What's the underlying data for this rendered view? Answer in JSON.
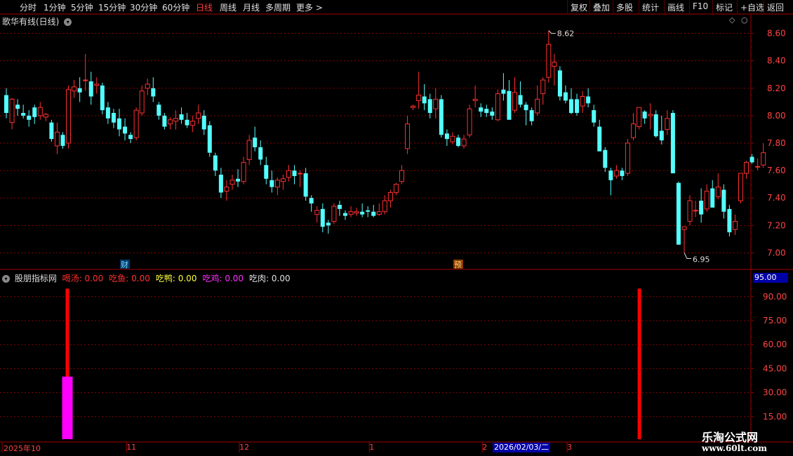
{
  "toolbar": {
    "periods": [
      "分时",
      "1分钟",
      "5分钟",
      "15分钟",
      "30分钟",
      "60分钟",
      "日线",
      "周线",
      "月线",
      "多周期",
      "更多 >"
    ],
    "active_period": "日线",
    "right_buttons": [
      "复权",
      "叠加",
      "多股",
      "统计",
      "画线",
      "F10",
      "标记",
      "+自选",
      "返回"
    ]
  },
  "main_panel": {
    "title": "歌华有线(日线)",
    "y_ticks": [
      "8.60",
      "8.40",
      "8.20",
      "8.00",
      "7.80",
      "7.60",
      "7.40",
      "7.20",
      "7.00"
    ],
    "high_marker": "8.62",
    "low_marker": "6.95",
    "event_markers": [
      {
        "label": "财",
        "index": 21
      },
      {
        "label": "预",
        "index": 80
      }
    ]
  },
  "indicator_panel": {
    "title": "股朋指标网",
    "indicators": [
      {
        "name": "喝汤",
        "value": "0.00",
        "color": "#ff3030"
      },
      {
        "name": "吃鱼",
        "value": "0.00",
        "color": "#ff3030"
      },
      {
        "name": "吃鸭",
        "value": "0.00",
        "color": "#ffff40"
      },
      {
        "name": "吃鸡",
        "value": "0.00",
        "color": "#ff30ff"
      },
      {
        "name": "吃肉",
        "value": "0.00",
        "color": "#e0e0e0"
      }
    ],
    "y_ticks": [
      "90.00",
      "75.00",
      "60.00",
      "45.00",
      "30.00",
      "15.00"
    ],
    "current_value": "95.00",
    "bars": [
      {
        "index": 10,
        "type": "line",
        "value": 95,
        "color": "#ff0000"
      },
      {
        "index": 10,
        "type": "box",
        "value": 40,
        "color": "#ff00ff"
      },
      {
        "index": 112,
        "type": "line",
        "value": 95,
        "color": "#ff0000"
      }
    ]
  },
  "x_axis": {
    "labels": [
      {
        "text": "2025年10",
        "index": 0
      },
      {
        "text": "11",
        "index": 22
      },
      {
        "text": "12",
        "index": 42
      },
      {
        "text": "1",
        "index": 65
      },
      {
        "text": "2",
        "index": 85
      },
      {
        "text": "3",
        "index": 100
      }
    ],
    "cursor_date": "2026/02/03/二"
  },
  "watermark": {
    "line1": "乐淘公式网",
    "line2": "www.60lt.com"
  },
  "colors": {
    "up": "#ff3030",
    "down": "#54ffff",
    "grid": "#8a0000",
    "axis_text": "#ff4444"
  },
  "chart_data": {
    "type": "candlestick",
    "ohlc": [
      [
        8.15,
        8.2,
        7.98,
        8.02
      ],
      [
        7.95,
        8.13,
        7.9,
        8.12
      ],
      [
        8.08,
        8.12,
        8.0,
        8.05
      ],
      [
        8.02,
        8.08,
        7.98,
        8.0
      ],
      [
        8.0,
        8.04,
        7.92,
        7.97
      ],
      [
        8.06,
        8.08,
        7.94,
        7.99
      ],
      [
        8.0,
        8.1,
        7.97,
        8.06
      ],
      [
        7.99,
        8.02,
        7.96,
        8.01
      ],
      [
        7.95,
        7.97,
        7.81,
        7.83
      ],
      [
        7.78,
        7.95,
        7.72,
        7.88
      ],
      [
        7.86,
        7.88,
        7.76,
        7.78
      ],
      [
        7.8,
        8.22,
        7.76,
        8.19
      ],
      [
        8.18,
        8.26,
        8.13,
        8.21
      ],
      [
        8.2,
        8.28,
        8.1,
        8.17
      ],
      [
        8.26,
        8.45,
        8.18,
        8.26
      ],
      [
        8.25,
        8.32,
        8.08,
        8.14
      ],
      [
        8.22,
        8.28,
        8.16,
        8.23
      ],
      [
        8.22,
        8.24,
        8.01,
        8.04
      ],
      [
        8.06,
        8.1,
        7.94,
        7.98
      ],
      [
        8.02,
        8.05,
        7.91,
        7.95
      ],
      [
        7.98,
        8.05,
        7.85,
        7.9
      ],
      [
        7.92,
        7.98,
        7.82,
        7.87
      ],
      [
        7.86,
        7.88,
        7.8,
        7.83
      ],
      [
        7.84,
        8.06,
        7.82,
        8.04
      ],
      [
        8.02,
        8.22,
        8.0,
        8.18
      ],
      [
        8.2,
        8.27,
        8.15,
        8.23
      ],
      [
        8.2,
        8.28,
        8.1,
        8.14
      ],
      [
        8.08,
        8.1,
        7.97,
        8.0
      ],
      [
        8.0,
        8.02,
        7.9,
        7.92
      ],
      [
        7.94,
        7.99,
        7.9,
        7.97
      ],
      [
        7.96,
        8.04,
        7.9,
        7.98
      ],
      [
        8.01,
        8.06,
        7.94,
        7.97
      ],
      [
        7.97,
        8.02,
        7.91,
        7.93
      ],
      [
        7.93,
        8.0,
        7.88,
        7.96
      ],
      [
        7.98,
        8.08,
        7.94,
        8.02
      ],
      [
        8.0,
        8.04,
        7.86,
        7.9
      ],
      [
        7.93,
        7.96,
        7.7,
        7.73
      ],
      [
        7.71,
        7.73,
        7.56,
        7.6
      ],
      [
        7.57,
        7.62,
        7.4,
        7.44
      ],
      [
        7.45,
        7.53,
        7.38,
        7.48
      ],
      [
        7.5,
        7.57,
        7.46,
        7.53
      ],
      [
        7.54,
        7.61,
        7.48,
        7.52
      ],
      [
        7.52,
        7.7,
        7.5,
        7.66
      ],
      [
        7.68,
        7.86,
        7.64,
        7.82
      ],
      [
        7.84,
        7.92,
        7.74,
        7.77
      ],
      [
        7.77,
        7.82,
        7.64,
        7.68
      ],
      [
        7.64,
        7.7,
        7.5,
        7.54
      ],
      [
        7.53,
        7.6,
        7.44,
        7.48
      ],
      [
        7.48,
        7.55,
        7.42,
        7.53
      ],
      [
        7.52,
        7.57,
        7.46,
        7.54
      ],
      [
        7.55,
        7.64,
        7.52,
        7.6
      ],
      [
        7.6,
        7.64,
        7.5,
        7.56
      ],
      [
        7.58,
        7.6,
        7.48,
        7.58
      ],
      [
        7.58,
        7.62,
        7.38,
        7.41
      ],
      [
        7.4,
        7.42,
        7.3,
        7.36
      ],
      [
        7.28,
        7.34,
        7.22,
        7.31
      ],
      [
        7.32,
        7.36,
        7.15,
        7.19
      ],
      [
        7.22,
        7.24,
        7.14,
        7.2
      ],
      [
        7.23,
        7.36,
        7.21,
        7.34
      ],
      [
        7.35,
        7.38,
        7.27,
        7.32
      ],
      [
        7.29,
        7.31,
        7.24,
        7.27
      ],
      [
        7.28,
        7.34,
        7.26,
        7.3
      ],
      [
        7.29,
        7.33,
        7.27,
        7.3
      ],
      [
        7.3,
        7.36,
        7.26,
        7.28
      ],
      [
        7.31,
        7.34,
        7.26,
        7.3
      ],
      [
        7.3,
        7.35,
        7.26,
        7.27
      ],
      [
        7.28,
        7.36,
        7.27,
        7.3
      ],
      [
        7.3,
        7.42,
        7.28,
        7.38
      ],
      [
        7.38,
        7.46,
        7.33,
        7.44
      ],
      [
        7.44,
        7.51,
        7.42,
        7.5
      ],
      [
        7.52,
        7.64,
        7.5,
        7.6
      ],
      [
        7.76,
        8.0,
        7.72,
        7.94
      ],
      [
        8.06,
        8.08,
        8.04,
        8.07
      ],
      [
        8.11,
        8.32,
        8.05,
        8.15
      ],
      [
        8.14,
        8.23,
        8.04,
        8.09
      ],
      [
        8.12,
        8.16,
        7.98,
        8.02
      ],
      [
        8.05,
        8.2,
        7.98,
        8.12
      ],
      [
        8.12,
        8.15,
        7.84,
        7.86
      ],
      [
        7.87,
        7.9,
        7.78,
        7.83
      ],
      [
        7.81,
        7.88,
        7.79,
        7.85
      ],
      [
        7.84,
        7.86,
        7.77,
        7.78
      ],
      [
        7.78,
        7.86,
        7.76,
        7.83
      ],
      [
        7.86,
        8.08,
        7.84,
        8.05
      ],
      [
        8.11,
        8.22,
        8.06,
        8.12
      ],
      [
        8.06,
        8.09,
        7.99,
        8.03
      ],
      [
        8.05,
        8.08,
        7.99,
        8.02
      ],
      [
        8.03,
        8.06,
        7.97,
        8.0
      ],
      [
        7.97,
        8.19,
        7.96,
        8.16
      ],
      [
        8.19,
        8.31,
        8.11,
        8.16
      ],
      [
        8.18,
        8.26,
        7.98,
        7.97
      ],
      [
        8.04,
        8.28,
        8.02,
        8.17
      ],
      [
        8.15,
        8.25,
        8.06,
        8.08
      ],
      [
        8.08,
        8.1,
        7.93,
        8.04
      ],
      [
        8.04,
        8.06,
        7.93,
        7.96
      ],
      [
        8.02,
        8.22,
        8.0,
        8.12
      ],
      [
        8.16,
        8.28,
        8.08,
        8.26
      ],
      [
        8.28,
        8.62,
        8.24,
        8.52
      ],
      [
        8.36,
        8.45,
        8.22,
        8.39
      ],
      [
        8.33,
        8.36,
        8.11,
        8.14
      ],
      [
        8.17,
        8.22,
        8.09,
        8.11
      ],
      [
        8.12,
        8.2,
        8.01,
        8.02
      ],
      [
        8.12,
        8.16,
        8.0,
        8.02
      ],
      [
        8.07,
        8.18,
        8.02,
        8.14
      ],
      [
        8.14,
        8.2,
        8.06,
        8.09
      ],
      [
        8.04,
        8.08,
        7.92,
        7.95
      ],
      [
        7.92,
        7.97,
        7.76,
        7.74
      ],
      [
        7.75,
        7.77,
        7.59,
        7.62
      ],
      [
        7.6,
        7.62,
        7.42,
        7.53
      ],
      [
        7.56,
        7.64,
        7.54,
        7.6
      ],
      [
        7.6,
        7.62,
        7.53,
        7.56
      ],
      [
        7.58,
        7.83,
        7.56,
        7.8
      ],
      [
        7.84,
        8.02,
        7.82,
        7.94
      ],
      [
        7.92,
        8.04,
        7.9,
        8.06
      ],
      [
        8.03,
        8.04,
        7.94,
        7.98
      ],
      [
        8.0,
        8.09,
        7.9,
        8.01
      ],
      [
        8.01,
        8.04,
        7.84,
        7.85
      ],
      [
        7.89,
        8.0,
        7.79,
        7.82
      ],
      [
        7.9,
        8.04,
        7.86,
        7.98
      ],
      [
        8.02,
        8.04,
        7.58,
        7.58
      ],
      [
        7.51,
        7.52,
        7.06,
        7.06
      ],
      [
        7.17,
        7.19,
        7.0,
        7.19
      ],
      [
        7.23,
        7.42,
        7.2,
        7.38
      ],
      [
        7.31,
        7.38,
        7.26,
        7.31
      ],
      [
        7.38,
        7.47,
        7.22,
        7.28
      ],
      [
        7.32,
        7.5,
        7.3,
        7.45
      ],
      [
        7.47,
        7.53,
        7.34,
        7.33
      ],
      [
        7.41,
        7.58,
        7.39,
        7.48
      ],
      [
        7.46,
        7.5,
        7.25,
        7.3
      ],
      [
        7.32,
        7.35,
        7.12,
        7.15
      ],
      [
        7.17,
        7.28,
        7.13,
        7.23
      ],
      [
        7.38,
        7.58,
        7.36,
        7.58
      ],
      [
        7.58,
        7.67,
        7.54,
        7.66
      ],
      [
        7.7,
        7.72,
        7.65,
        7.66
      ],
      [
        7.63,
        7.69,
        7.6,
        7.63
      ],
      [
        7.64,
        7.8,
        7.62,
        7.73
      ]
    ],
    "ylim": [
      6.9,
      8.7
    ],
    "indicator_ylim": [
      0,
      100
    ]
  }
}
